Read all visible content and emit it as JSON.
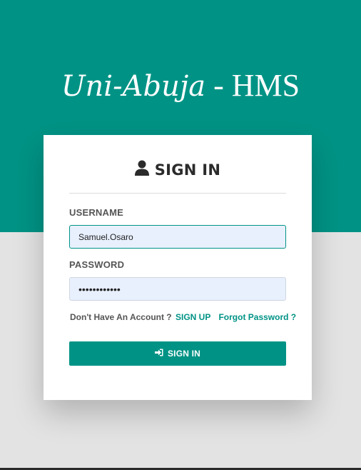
{
  "brand": {
    "script_text": "Uni-Abuja",
    "separator": " - ",
    "suffix_text": "HMS"
  },
  "card": {
    "title": "SIGN IN",
    "title_icon": "user-icon"
  },
  "form": {
    "username_label": "USERNAME",
    "username_value": "Samuel.Osaro",
    "password_label": "PASSWORD",
    "password_value": "••••••••••••"
  },
  "links": {
    "no_account_text": "Don't Have An Account ?",
    "signup_label": "SIGN UP",
    "forgot_label": "Forgot Password ?"
  },
  "button": {
    "label": "SIGN IN",
    "icon": "sign-in-icon"
  },
  "colors": {
    "primary": "#009385",
    "background": "#e3e3e3",
    "input_bg": "#e8f0fe"
  }
}
